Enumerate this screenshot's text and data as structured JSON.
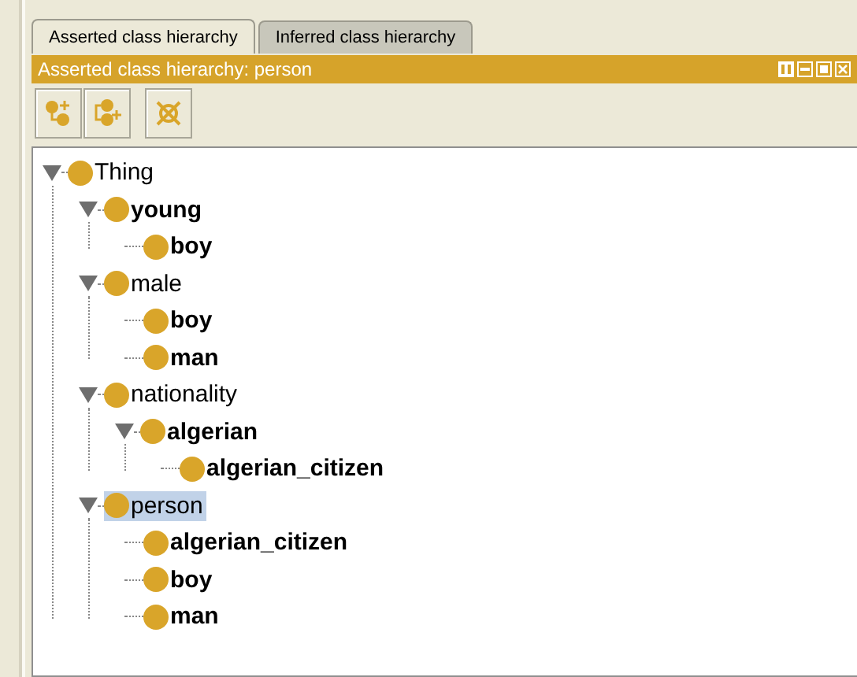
{
  "tabs": [
    {
      "label": "Asserted class hierarchy",
      "selected": true
    },
    {
      "label": "Inferred class hierarchy",
      "selected": false
    }
  ],
  "panel": {
    "title": "Asserted class hierarchy: person"
  },
  "tree": [
    {
      "label": "Thing",
      "bold": false,
      "selected": false,
      "expanded": true,
      "children": [
        {
          "label": "young",
          "bold": true,
          "selected": false,
          "expanded": true,
          "children": [
            {
              "label": "boy",
              "bold": true,
              "selected": false
            }
          ]
        },
        {
          "label": "male",
          "bold": false,
          "selected": false,
          "expanded": true,
          "children": [
            {
              "label": "boy",
              "bold": true,
              "selected": false
            },
            {
              "label": "man",
              "bold": true,
              "selected": false
            }
          ]
        },
        {
          "label": "nationality",
          "bold": false,
          "selected": false,
          "expanded": true,
          "children": [
            {
              "label": "algerian",
              "bold": true,
              "selected": false,
              "expanded": true,
              "children": [
                {
                  "label": "algerian_citizen",
                  "bold": true,
                  "selected": false
                }
              ]
            }
          ]
        },
        {
          "label": "person",
          "bold": false,
          "selected": true,
          "expanded": true,
          "children": [
            {
              "label": "algerian_citizen",
              "bold": true,
              "selected": false
            },
            {
              "label": "boy",
              "bold": true,
              "selected": false
            },
            {
              "label": "man",
              "bold": true,
              "selected": false
            }
          ]
        }
      ]
    }
  ]
}
